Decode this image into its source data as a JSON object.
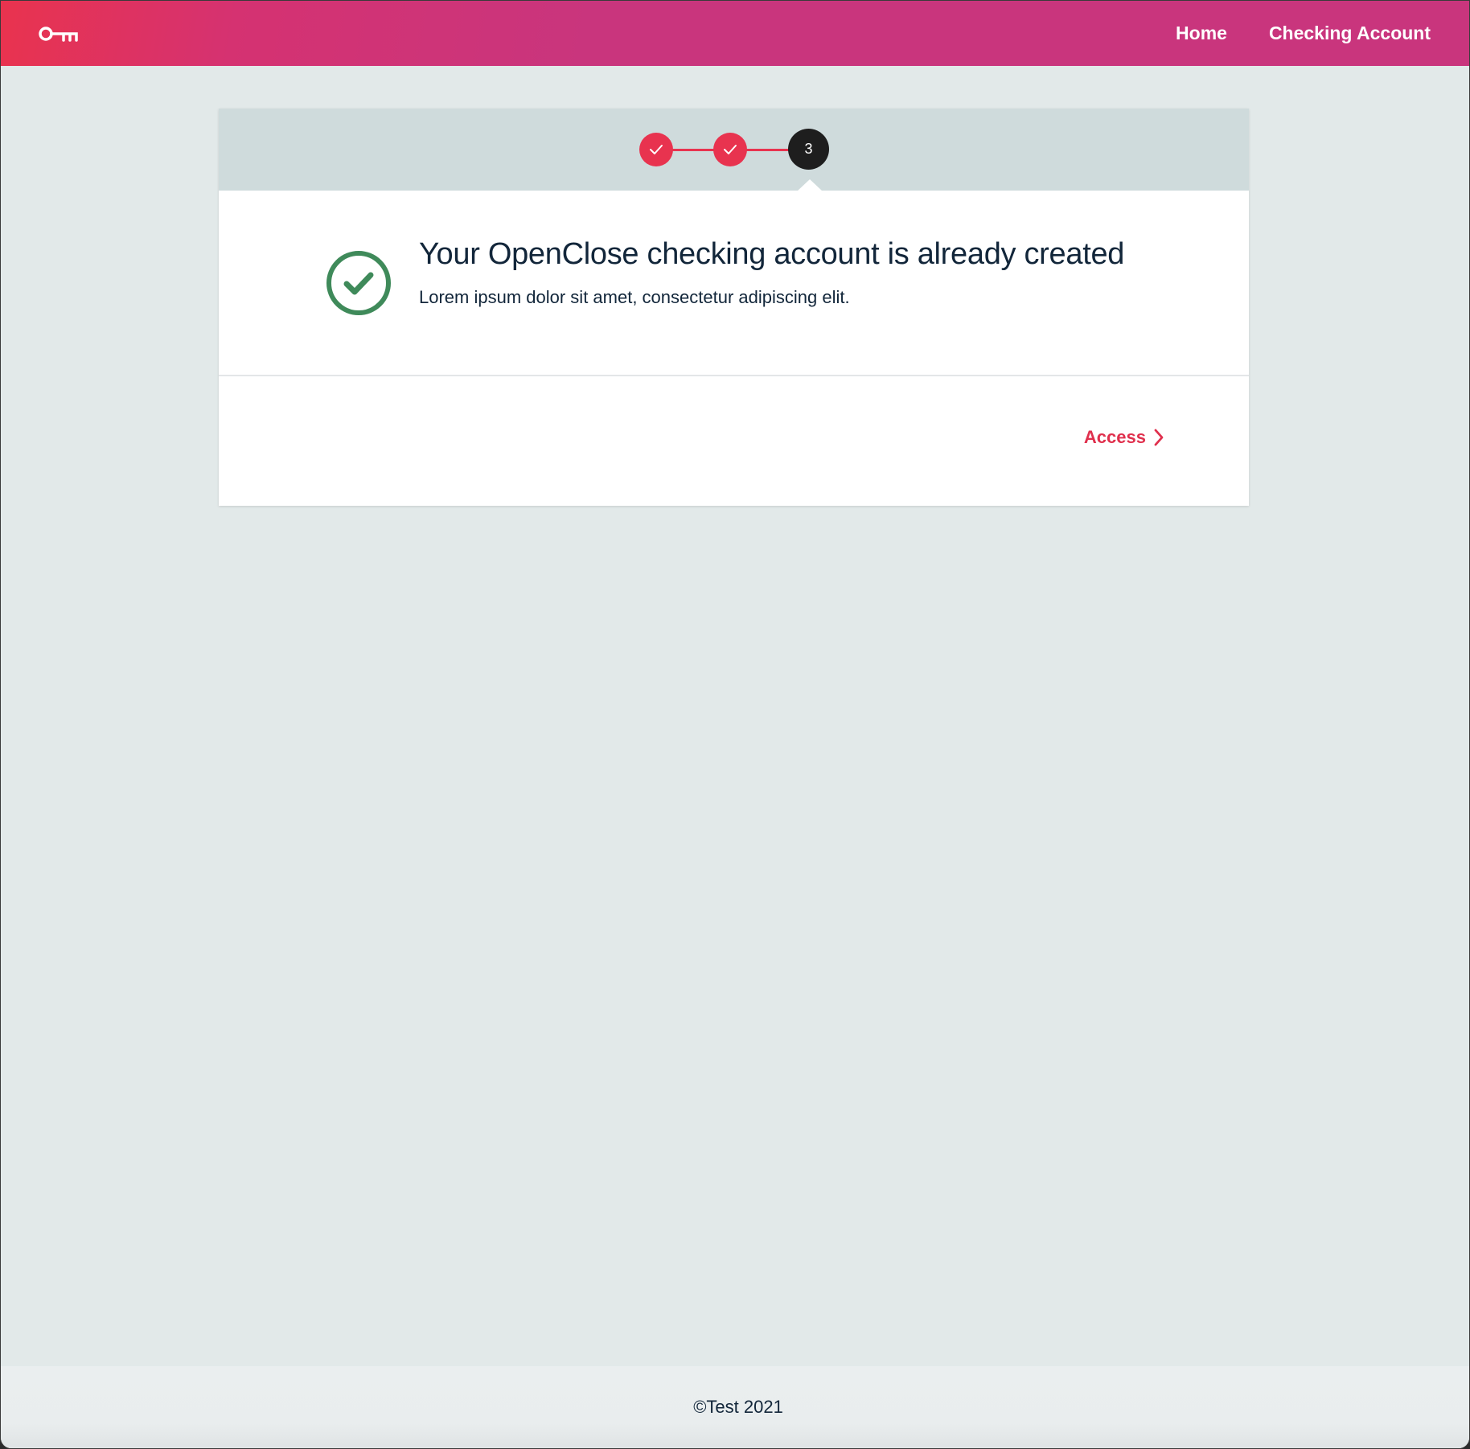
{
  "colors": {
    "brand_start": "#e9334e",
    "brand_end": "#c9357d",
    "accent": "#e8334f",
    "success": "#3f8a5a",
    "text_dark": "#12263a",
    "background": "#e2e9e9"
  },
  "navbar": {
    "logo_icon": "key-icon",
    "links": [
      {
        "label": "Home"
      },
      {
        "label": "Checking Account"
      }
    ]
  },
  "stepper": {
    "steps": [
      {
        "status": "complete",
        "icon": "check-icon"
      },
      {
        "status": "complete",
        "icon": "check-icon"
      },
      {
        "status": "current",
        "label": "3"
      }
    ]
  },
  "message": {
    "icon": "check-circle-icon",
    "title": "Your OpenClose checking account is already created",
    "subtitle": "Lorem ipsum dolor sit amet, consectetur adipiscing elit."
  },
  "actions": {
    "access_label": "Access",
    "access_icon": "chevron-right-icon"
  },
  "footer": {
    "text": "©Test 2021"
  }
}
